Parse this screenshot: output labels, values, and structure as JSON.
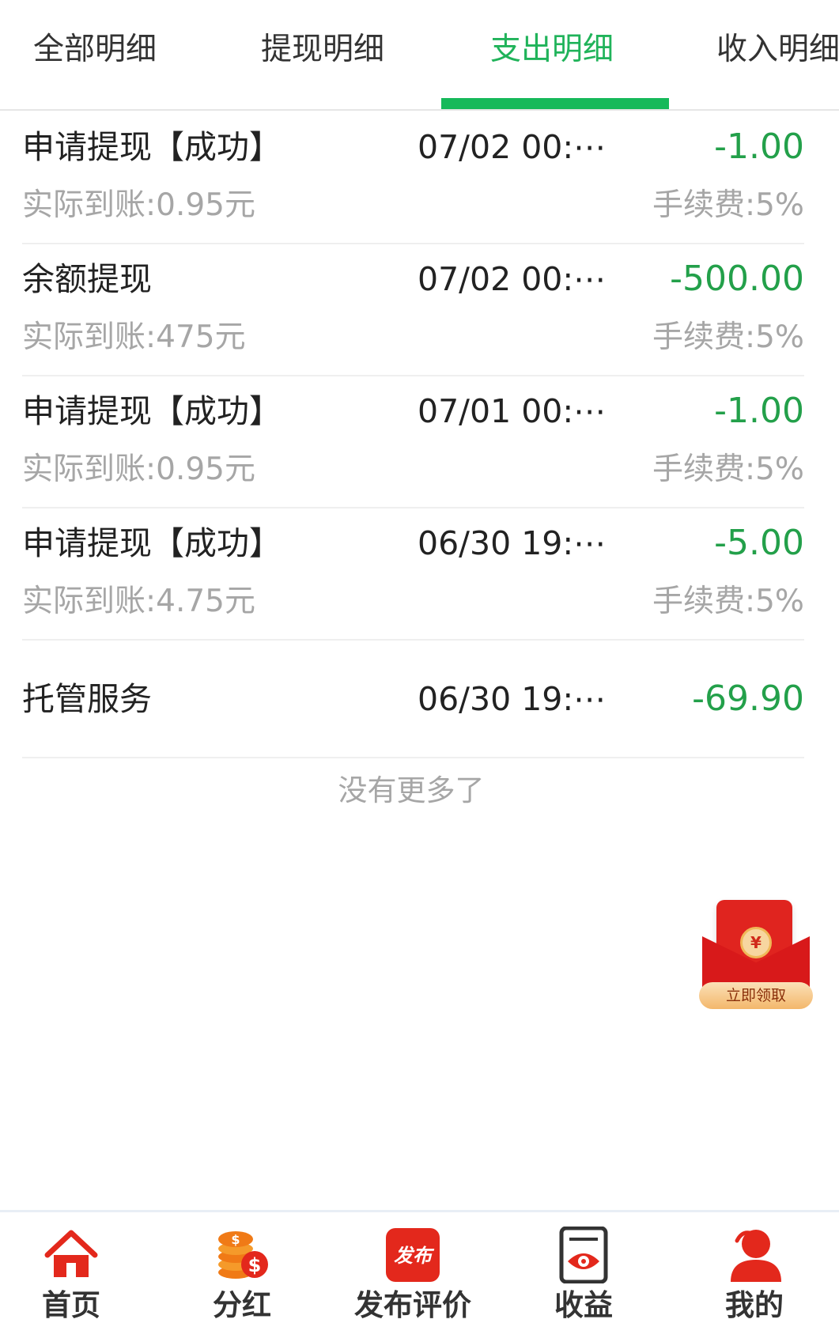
{
  "tabs": [
    {
      "label": "全部明细",
      "active": false
    },
    {
      "label": "提现明细",
      "active": false
    },
    {
      "label": "支出明细",
      "active": true
    },
    {
      "label": "收入明细",
      "active": false
    }
  ],
  "accent_color": "#20b35a",
  "amount_color": "#23a04a",
  "records": [
    {
      "title": "申请提现【成功】",
      "time": "07/02 00:⋯",
      "amount": "-1.00",
      "actual": "实际到账:0.95元",
      "fee": "手续费:5%"
    },
    {
      "title": "余额提现",
      "time": "07/02 00:⋯",
      "amount": "-500.00",
      "actual": "实际到账:475元",
      "fee": "手续费:5%"
    },
    {
      "title": "申请提现【成功】",
      "time": "07/01 00:⋯",
      "amount": "-1.00",
      "actual": "实际到账:0.95元",
      "fee": "手续费:5%"
    },
    {
      "title": "申请提现【成功】",
      "time": "06/30 19:⋯",
      "amount": "-5.00",
      "actual": "实际到账:4.75元",
      "fee": "手续费:5%"
    },
    {
      "title": "托管服务",
      "time": "06/30 19:⋯",
      "amount": "-69.90"
    }
  ],
  "no_more": "没有更多了",
  "red_packet": {
    "button_label": "立即领取",
    "coin_symbol": "¥",
    "icon": "red-packet-icon"
  },
  "bottom_nav": [
    {
      "label": "首页",
      "icon": "home-icon"
    },
    {
      "label": "分红",
      "icon": "coins-icon"
    },
    {
      "label": "发布评价",
      "icon": "publish-icon",
      "icon_text": "发布"
    },
    {
      "label": "收益",
      "icon": "earnings-eye-icon"
    },
    {
      "label": "我的",
      "icon": "user-icon"
    }
  ]
}
